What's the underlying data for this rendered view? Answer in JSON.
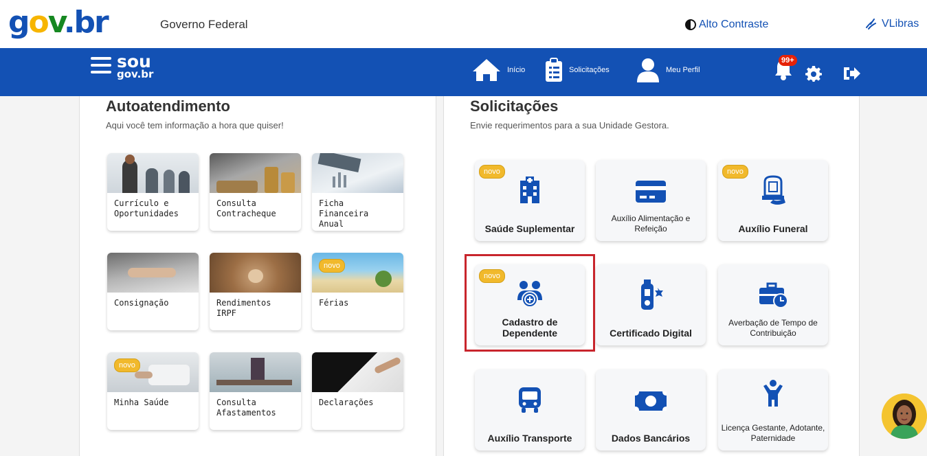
{
  "header": {
    "logo": {
      "g": "g",
      "o": "o",
      "v": "v",
      "br": ".br"
    },
    "government": "Governo Federal",
    "contrast": "Alto Contraste",
    "vlibras": "VLibras"
  },
  "navbar": {
    "brand_top": "sou",
    "brand_bottom": "gov.br",
    "items": [
      {
        "label": "Início",
        "icon": "home-icon"
      },
      {
        "label": "Solicitações",
        "icon": "clipboard-icon"
      },
      {
        "label": "Meu Perfil",
        "icon": "user-icon"
      }
    ],
    "notifications": "99+"
  },
  "self_service": {
    "title": "Autoatendimento",
    "subtitle": "Aqui você tem informação a hora que quiser!",
    "badge": "novo",
    "cards": [
      {
        "label": "Currículo e Oportunidades",
        "new": false
      },
      {
        "label": "Consulta Contracheque",
        "new": false
      },
      {
        "label": "Ficha Financeira Anual",
        "new": false
      },
      {
        "label": "Consignação",
        "new": false
      },
      {
        "label": "Rendimentos IRPF",
        "new": false
      },
      {
        "label": "Férias",
        "new": true
      },
      {
        "label": "Minha Saúde",
        "new": true
      },
      {
        "label": "Consulta Afastamentos",
        "new": false
      },
      {
        "label": "Declarações",
        "new": false
      }
    ]
  },
  "requests": {
    "title": "Solicitações",
    "subtitle": "Envie requerimentos para a sua Unidade Gestora.",
    "badge": "novo",
    "cards": [
      {
        "label": "Saúde Suplementar",
        "icon": "hospital-icon",
        "new": true
      },
      {
        "label": "Auxílio Alimentação e Refeição",
        "icon": "card-icon",
        "new": false
      },
      {
        "label": "Auxílio Funeral",
        "icon": "funeral-icon",
        "new": true
      },
      {
        "label": "Cadastro de Dependente",
        "icon": "dependents-icon",
        "new": true
      },
      {
        "label": "Certificado Digital",
        "icon": "certificate-icon",
        "new": false
      },
      {
        "label": "Averbação de Tempo de Contribuição",
        "icon": "briefcase-clock-icon",
        "new": false
      },
      {
        "label": "Auxílio Transporte",
        "icon": "bus-icon",
        "new": false
      },
      {
        "label": "Dados Bancários",
        "icon": "money-icon",
        "new": false
      },
      {
        "label": "Licença Gestante, Adotante, Paternidade",
        "icon": "child-icon",
        "new": false
      }
    ]
  },
  "colors": {
    "primary": "#1351b4",
    "badge": "#f1b92c",
    "highlight": "#c8252c"
  }
}
